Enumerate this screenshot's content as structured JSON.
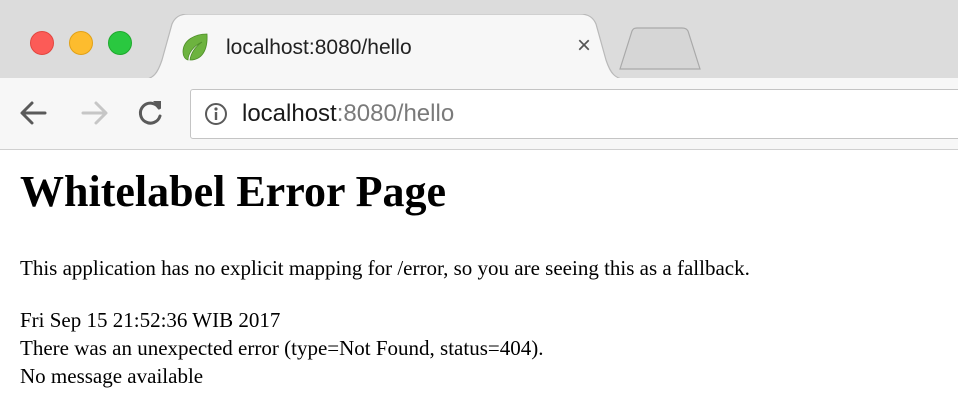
{
  "browser": {
    "tab": {
      "title": "localhost:8080/hello",
      "close_glyph": "×",
      "favicon": "spring-leaf-icon"
    },
    "address_bar": {
      "host": "localhost",
      "rest": ":8080/hello"
    },
    "colors": {
      "close": "#fc5b57",
      "minimize": "#fdbc2e",
      "maximize": "#2ac840",
      "favicon": "#6db33f"
    }
  },
  "page": {
    "title": "Whitelabel Error Page",
    "explanation": "This application has no explicit mapping for /error, so you are seeing this as a fallback.",
    "timestamp": "Fri Sep 15 21:52:36 WIB 2017",
    "error_line": "There was an unexpected error (type=Not Found, status=404).",
    "message": "No message available"
  }
}
